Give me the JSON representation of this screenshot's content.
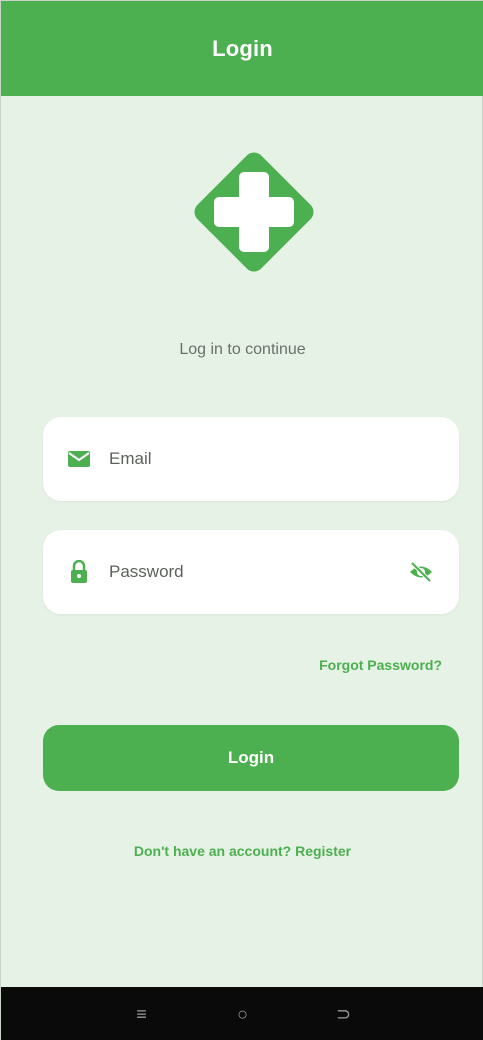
{
  "appbar": {
    "title": "Login"
  },
  "logo": {
    "icon": "medical-cross-logo",
    "color": "#4caf50"
  },
  "subtitle": "Log in to continue",
  "form": {
    "email": {
      "placeholder": "Email",
      "icon": "mail-icon"
    },
    "password": {
      "placeholder": "Password",
      "icon": "lock-icon",
      "toggle_icon": "eye-off-icon"
    },
    "forgot_label": "Forgot Password?",
    "login_label": "Login",
    "register_text": "Don't have an account? Register"
  },
  "navbar": {
    "menu_icon": "≡",
    "home_icon": "○",
    "back_icon": "⊃"
  },
  "colors": {
    "primary": "#4caf50",
    "background": "#e6f2e5",
    "field_background": "#ffffff"
  }
}
